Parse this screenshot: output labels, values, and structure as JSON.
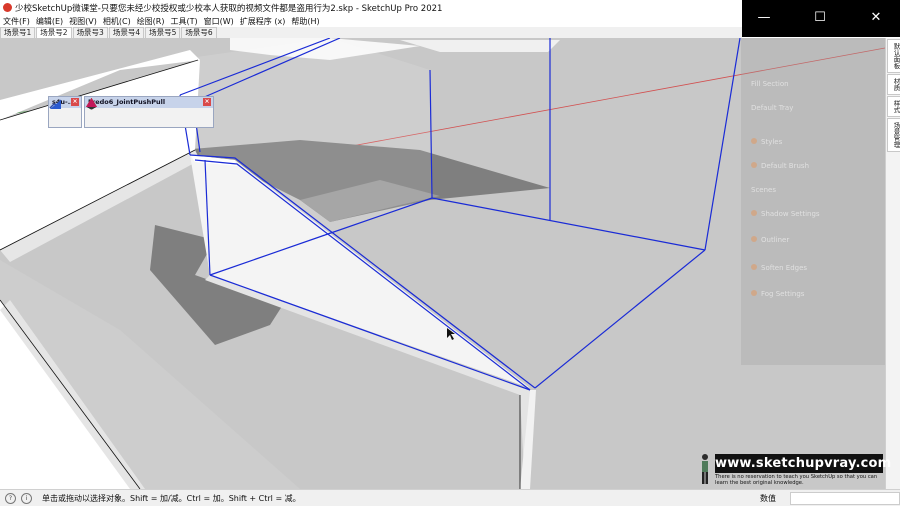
{
  "window": {
    "title": "少校SketchUp微课堂-只要您未经少校授权或少校本人获取的视频文件都是盗用行为2.skp - SketchUp Pro 2021",
    "minimize": "—",
    "maximize": "☐",
    "close": "✕"
  },
  "menu": [
    "文件(F)",
    "编辑(E)",
    "视图(V)",
    "相机(C)",
    "绘图(R)",
    "工具(T)",
    "窗口(W)",
    "扩展程序 (x)",
    "帮助(H)"
  ],
  "scene_tabs": [
    "场景号1",
    "场景号2",
    "场景号3",
    "场景号4",
    "场景号5",
    "场景号6"
  ],
  "active_scene_tab": "场景号2",
  "toolbars": {
    "s4u": {
      "title": "s4u-...",
      "close": "×"
    },
    "fredo": {
      "title": "Fredo6_JointPushPull",
      "close": "×"
    }
  },
  "right_panel_tabs": [
    "默认面板",
    "材质",
    "样式",
    "场景管理"
  ],
  "ghost_panel": [
    "Fill Section",
    "Default Tray",
    "Styles",
    "Default Brush",
    "Scenes",
    "Shadow Settings",
    "Outliner",
    "Soften Edges",
    "Fog Settings"
  ],
  "watermark": {
    "url": "www.sketchupvray.com",
    "tagline": "There is no reservation to teach you SketchUp so that you can learn the best original knowledge."
  },
  "status": {
    "hint": "单击或拖动以选择对象。Shift = 加/减。Ctrl = 加。Shift + Ctrl = 减。",
    "measure_label": "数值",
    "measure_value": ""
  },
  "colors": {
    "selection": "#1a2bd6",
    "viewport": "#c9c9c9",
    "shadow": "#7f7f7f",
    "red_axis": "#d25050",
    "green_axis": "#5a9a5a"
  },
  "icons": [
    "app-icon",
    "info-icon",
    "help-icon",
    "figure-icon"
  ]
}
